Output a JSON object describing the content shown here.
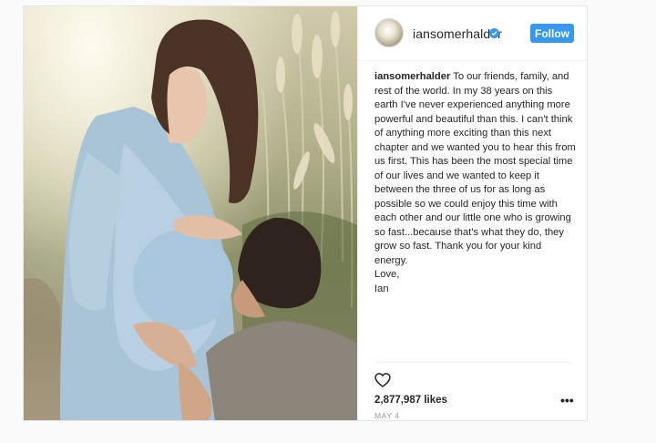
{
  "post": {
    "username": "iansomerhalder",
    "follow_label": "Follow",
    "caption_username": "iansomerhalder",
    "caption_text": " To our friends, family, and rest of the world. In my 38 years on this earth I've never experienced anything more powerful and beautiful than this. I can't think of anything more exciting than this next chapter and we wanted you to hear this from us first. This has been the most special time of our lives and we wanted to keep it between the three of us for as long as possible so we could enjoy this time with each other and our little one who is growing so fast...because that's what they do, they grow so fast. Thank you for your kind energy.\nLove,\nIan",
    "likes": "2,877,987 likes",
    "date": "MAY 4",
    "more": "•••"
  },
  "colors": {
    "accent": "#3897f0",
    "text": "#262626",
    "muted": "#999999"
  },
  "icons": {
    "verified": "verified-badge-icon",
    "like": "heart-icon",
    "more": "more-options-icon"
  }
}
